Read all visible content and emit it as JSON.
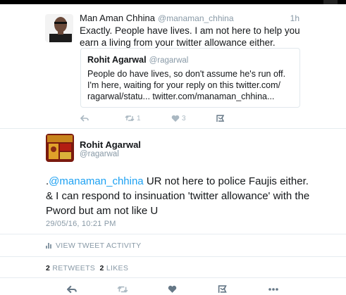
{
  "reply_tweet": {
    "display_name": "Man Aman Chhina",
    "handle": "@manaman_chhina",
    "time": "1h",
    "text": "Exactly. People have lives. I am not here to help you earn a living from your twitter allowance either.",
    "quoted": {
      "display_name": "Rohit Agarwal",
      "handle": "@ragarwal",
      "text": "People do have lives, so don't assume he's run off. I'm here, waiting for your reply on this twitter.com/ ragarwal/statu... twitter.com/manaman_chhina..."
    },
    "retweet_count": "1",
    "like_count": "3",
    "icons": [
      "reply-icon",
      "retweet-icon",
      "like-icon",
      "direct-message-icon"
    ]
  },
  "main_tweet": {
    "display_name": "Rohit Agarwal",
    "handle": "@ragarwal",
    "text_prefix": ".",
    "mention": "@manaman_chhina",
    "text_rest": " UR not here to police Faujis either. & I can respond to insinuation 'twitter allowance' with the Pword but am not like U",
    "timestamp": "29/05/16, 10:21 PM",
    "activity_label": "VIEW TWEET ACTIVITY",
    "retweets_count": "2",
    "retweets_label": "RETWEETS",
    "likes_count": "2",
    "likes_label": "LIKES",
    "icons": [
      "reply-icon",
      "retweet-icon",
      "like-icon",
      "direct-message-icon",
      "more-icon"
    ]
  },
  "colors": {
    "link": "#1da1f2",
    "muted": "#8899a6",
    "icon": "#657786",
    "icon_light": "#aab8c2",
    "border": "#e1e8ed"
  }
}
